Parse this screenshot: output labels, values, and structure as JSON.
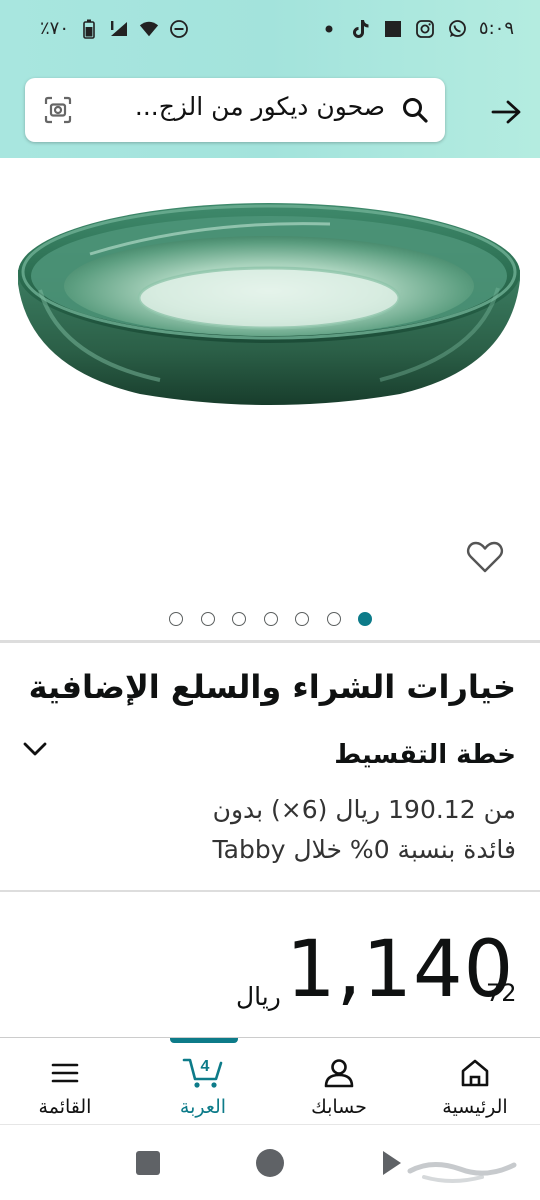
{
  "status_bar": {
    "time": "٥:٠٩",
    "battery": "٪٧٠",
    "left_icons": [
      "battery-icon",
      "signal-icon",
      "wifi-icon",
      "dnd-icon"
    ],
    "right_icons": [
      "whatsapp-icon",
      "instagram-icon",
      "square-app-icon",
      "tiktok-icon",
      "dot-icon"
    ]
  },
  "search": {
    "query": "صحون ديكور من الزج..."
  },
  "gallery": {
    "total_images": 7,
    "active_index": 6
  },
  "purchase_options": {
    "title": "خيارات الشراء والسلع الإضافية",
    "plan_title": "خطة التقسيط",
    "plan_line1": "من 190.12 ريال (6×) بدون",
    "plan_line2": "فائدة بنسبة 0% خلال Tabby"
  },
  "price": {
    "whole": "1,140",
    "fraction": "72",
    "currency": "ريال"
  },
  "bottom_nav": {
    "items": [
      {
        "label": "الرئيسية",
        "icon": "home-icon"
      },
      {
        "label": "حسابك",
        "icon": "account-icon"
      },
      {
        "label": "العربة",
        "icon": "cart-icon",
        "badge": "4",
        "active": true
      },
      {
        "label": "القائمة",
        "icon": "menu-icon"
      }
    ]
  },
  "colors": {
    "accent": "#0d7b89",
    "header_bg": "#a8e6df",
    "glass_green": "#2f7a5a"
  }
}
